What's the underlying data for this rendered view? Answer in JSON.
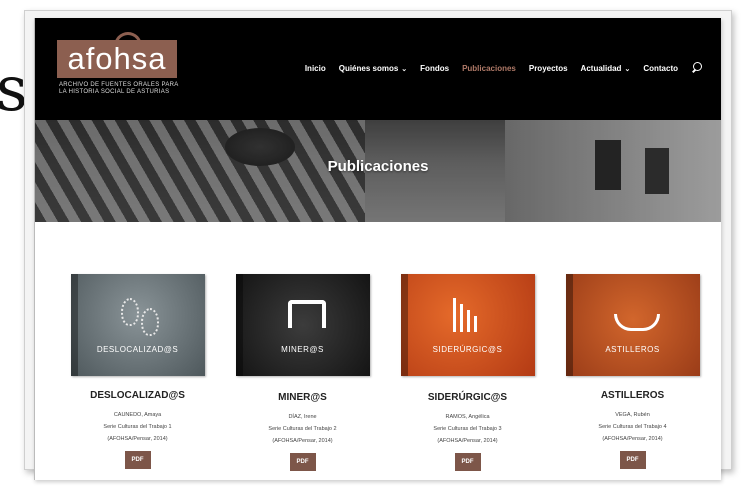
{
  "partial_left_text": "s",
  "brand": {
    "logo_text": "afohsa",
    "tagline_line1": "ARCHIVO DE FUENTES ORALES PARA",
    "tagline_line2": "LA HISTORIA SOCIAL DE ASTURIAS",
    "color": "#8c5f50"
  },
  "nav": {
    "items": [
      {
        "label": "Inicio",
        "active": false,
        "dropdown": false
      },
      {
        "label": "Quiénes somos",
        "active": false,
        "dropdown": true
      },
      {
        "label": "Fondos",
        "active": false,
        "dropdown": false
      },
      {
        "label": "Publicaciones",
        "active": true,
        "dropdown": false
      },
      {
        "label": "Proyectos",
        "active": false,
        "dropdown": false
      },
      {
        "label": "Actualidad",
        "active": false,
        "dropdown": true
      },
      {
        "label": "Contacto",
        "active": false,
        "dropdown": false
      }
    ],
    "search_icon": "search-icon",
    "active_color": "#b07a68"
  },
  "hero": {
    "title": "Publicaciones"
  },
  "books": [
    {
      "cover_title": "DESLOCALIZAD@S",
      "title": "DESLOCALIZAD@S",
      "author": "CAUNEDO, Amaya",
      "series": "Serie Culturas del Trabajo 1",
      "publisher": "(AFOHSA/Pensar, 2014)",
      "button": "PDF"
    },
    {
      "cover_title": "MINER@S",
      "title": "MINER@S",
      "author": "DÍAZ, Irene",
      "series": "Serie Culturas del Trabajo 2",
      "publisher": "(AFOHSA/Pensar, 2014)",
      "button": "PDF"
    },
    {
      "cover_title": "SIDERÚRGIC@S",
      "title": "SIDERÚRGIC@S",
      "author": "RAMOS, Angélica",
      "series": "Serie Culturas del Trabajo 3",
      "publisher": "(AFOHSA/Pensar, 2014)",
      "button": "PDF"
    },
    {
      "cover_title": "ASTILLEROS",
      "title": "ASTILLEROS",
      "author": "VEGA, Rubén",
      "series": "Serie Culturas del Trabajo 4",
      "publisher": "(AFOHSA/Pensar, 2014)",
      "button": "PDF"
    }
  ]
}
